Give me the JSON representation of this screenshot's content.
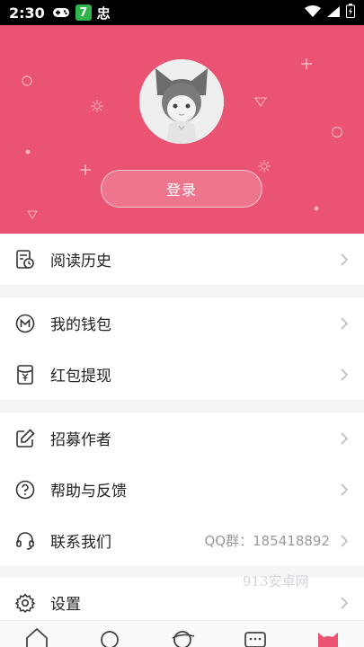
{
  "statusbar": {
    "time": "2:30",
    "badge": "7",
    "bug_glyph": "忠"
  },
  "header": {
    "login_label": "登录",
    "bg_color": "#ea5372"
  },
  "menu": {
    "reading_history": "阅读历史",
    "wallet": "我的钱包",
    "red_packet": "红包提现",
    "recruit_author": "招募作者",
    "help_feedback": "帮助与反馈",
    "contact_us": "联系我们",
    "qq_group": "QQ群：185418892",
    "settings": "设置"
  },
  "watermark": "913安卓网",
  "bottom_nav": [
    "home-icon",
    "search-icon",
    "discover-icon",
    "message-icon",
    "profile-icon"
  ]
}
